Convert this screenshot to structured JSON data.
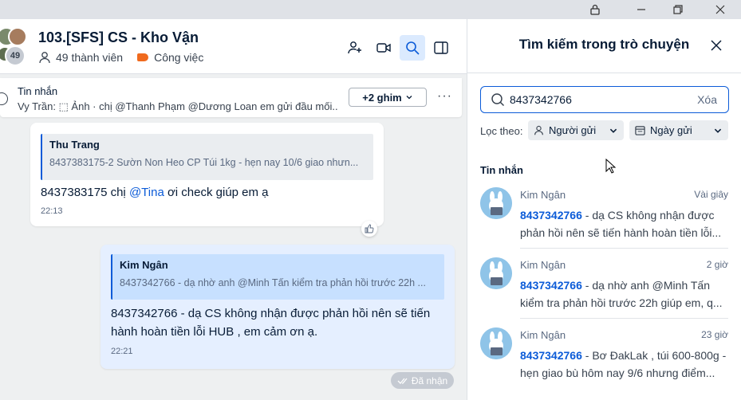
{
  "header": {
    "group_name": "103.[SFS] CS - Kho Vận",
    "member_count_badge": "49",
    "members_label": "49 thành viên",
    "tag_label": "Công việc",
    "tag_color": "#f06a1e",
    "icons": [
      "add-member-icon",
      "video-call-icon",
      "search-icon",
      "toggle-panel-icon"
    ]
  },
  "pinned": {
    "title": "Tin nhắn",
    "preview": "Vy Trần: ⬚ Ảnh · chị @Thanh Phạm @Dương Loan em gửi đầu mối...",
    "more_button": "+2 ghim"
  },
  "messages": [
    {
      "quote_name": "Thu Trang",
      "quote_text": "8437383175-2 Sườn Non Heo CP Túi 1kg - hẹn nay 10/6 giao nhưn...",
      "text_before": "8437383175 chị ",
      "mention": "@Tina",
      "text_after": " ơi check giúp em ạ",
      "time": "22:13"
    },
    {
      "quote_name": "Kim Ngân",
      "quote_text": "8437342766 - dạ nhờ anh @Minh Tấn kiểm tra phản hồi trước 22h ...",
      "text": "8437342766  - dạ CS không  nhận được phản hồi nên sẽ tiến hành hoàn tiền lỗi HUB , em cảm ơn ạ.",
      "time": "22:21",
      "status": "Đã nhận"
    }
  ],
  "search_panel": {
    "title": "Tìm kiếm trong trò chuyện",
    "query": "8437342766",
    "clear_label": "Xóa",
    "filter_label": "Lọc theo:",
    "filter_sender": "Người gửi",
    "filter_date": "Ngày gửi",
    "section_title": "Tin nhắn",
    "results": [
      {
        "name": "Kim Ngân",
        "time": "Vài giây",
        "highlight": "8437342766",
        "snippet": " - dạ CS không nhận được phản hồi nên sẽ tiến hành hoàn tiền lỗi..."
      },
      {
        "name": "Kim Ngân",
        "time": "2 giờ",
        "highlight": "8437342766",
        "snippet": " - dạ nhờ anh @Minh Tấn kiểm tra phản hồi trước 22h giúp em, q..."
      },
      {
        "name": "Kim Ngân",
        "time": "23 giờ",
        "highlight": "8437342766",
        "snippet": " - Bơ ĐakLak , túi 600-800g - hẹn giao bù hôm nay 9/6 nhưng điểm..."
      }
    ]
  },
  "colors": {
    "accent": "#0b5bd8",
    "sent_bubble": "#e5efff",
    "chat_bg": "#eef0f1"
  }
}
